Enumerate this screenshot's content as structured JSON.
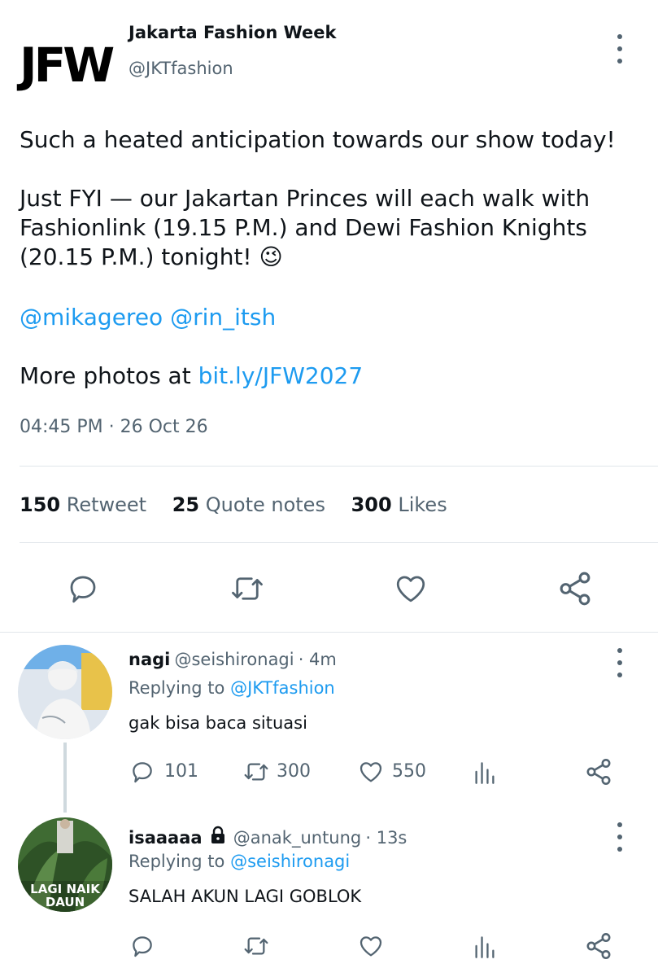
{
  "tweet": {
    "logo_text": "JFW",
    "author_name": "Jakarta Fashion Week",
    "author_handle": "@JKTfashion",
    "line1": "Such a heated anticipation towards our show today!",
    "line2a": "Just FYI — our Jakartan Princes will each walk with",
    "line2b": "Fashionlink (19.15 P.M.) and Dewi Fashion Knights",
    "line2c": "(20.15 P.M.) tonight! 😉",
    "mention1": "@mikagereo",
    "mention2": "@rin_itsh",
    "photos_prefix": "More photos at ",
    "photos_link": "bit.ly/JFW2027",
    "timestamp": "04:45 PM · 26 Oct 26",
    "stats": {
      "retweet_count": "150",
      "retweet_label": "Retweet",
      "quote_count": "25",
      "quote_label": "Quote notes",
      "likes_count": "300",
      "likes_label": "Likes"
    }
  },
  "replies": [
    {
      "name": "nagi",
      "handle": "@seishironagi",
      "time": "· 4m",
      "replying_prefix": "Replying to ",
      "replying_to": "@JKTfashion",
      "text": "gak bisa baca situasi",
      "comments": "101",
      "retweets": "300",
      "likes": "550"
    },
    {
      "name": "isaaaaa",
      "handle": "@anak_untung",
      "time": "· 13s",
      "replying_prefix": "Replying to ",
      "replying_to": "@seishironagi",
      "text": "SALAH AKUN LAGI GOBLOK",
      "avatar_caption_1": "LAGI NAIK",
      "avatar_caption_2": "DAUN"
    }
  ],
  "colors": {
    "link": "#1d9bf0",
    "secondary_text": "#536471",
    "icon": "#536471",
    "divider": "#e1e6ea"
  },
  "icons": [
    "more-icon",
    "comment-icon",
    "retweet-icon",
    "like-icon",
    "share-icon",
    "stats-icon",
    "lock-icon"
  ]
}
